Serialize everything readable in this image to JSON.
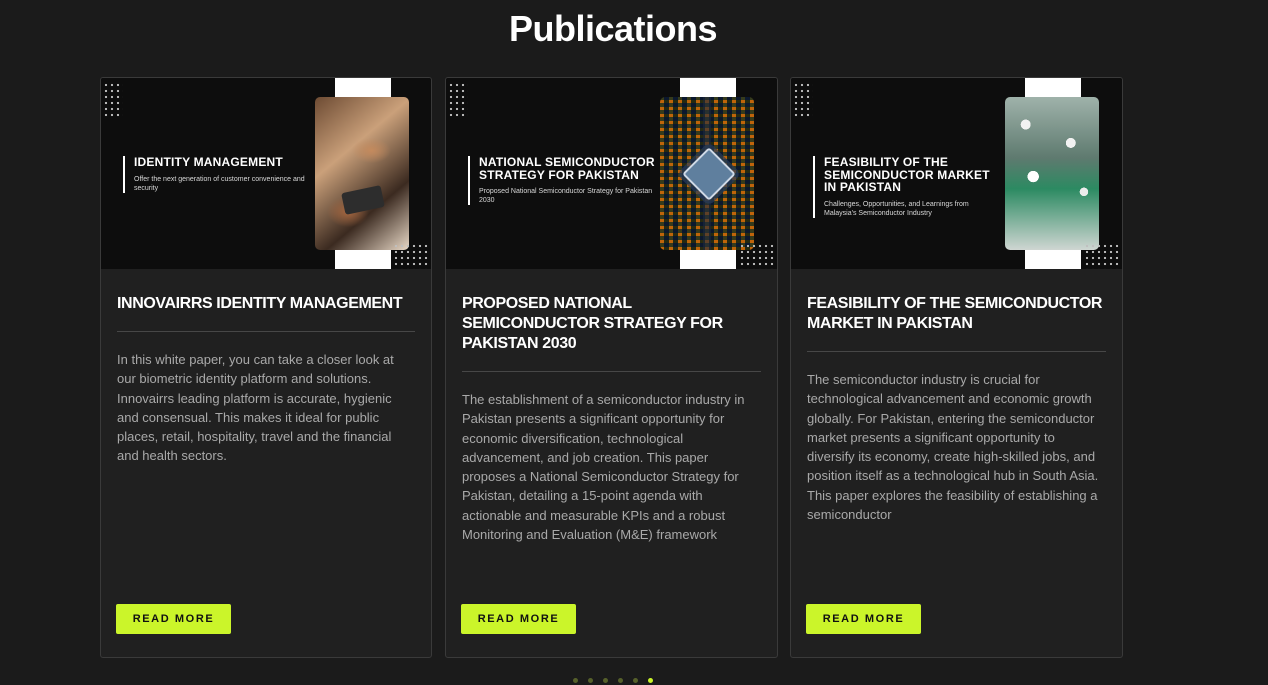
{
  "page": {
    "title": "Publications"
  },
  "cards": [
    {
      "cover_heading": "IDENTITY MANAGEMENT",
      "cover_sub": "Offer the next generation of customer convenience and security",
      "title": "INNOVAIRRS IDENTITY MANAGEMENT",
      "description": "In this white paper, you can take a closer look at our biometric identity platform and solutions. Innovairrs leading platform is accurate, hygienic and consensual. This makes it ideal for public places, retail, hospitality, travel and the financial and health sectors.",
      "button_label": "READ MORE"
    },
    {
      "cover_heading": "NATIONAL SEMICONDUCTOR STRATEGY FOR PAKISTAN",
      "cover_sub": "Proposed National Semiconductor Strategy for Pakistan 2030",
      "title": "PROPOSED NATIONAL SEMICONDUCTOR STRATEGY FOR PAKISTAN 2030",
      "description": "The establishment of a semiconductor industry in Pakistan presents a significant opportunity for economic diversification, technological advancement, and job creation. This paper proposes a National Semiconductor Strategy for Pakistan, detailing a 15-point agenda with actionable and measurable KPIs and a robust Monitoring and Evaluation (M&E) framework",
      "button_label": "READ MORE"
    },
    {
      "cover_heading": "FEASIBILITY OF THE SEMICONDUCTOR MARKET IN PAKISTAN",
      "cover_sub": "Challenges, Opportunities, and Learnings from Malaysia's Semiconductor Industry",
      "title": "FEASIBILITY OF THE SEMICONDUCTOR MARKET IN PAKISTAN",
      "description": "The semiconductor industry is crucial for technological advancement and economic growth globally. For Pakistan, entering the semiconductor market presents a significant opportunity to diversify its economy, create high-skilled jobs, and position itself as a technological hub in South Asia. This paper explores the feasibility of establishing a semiconductor",
      "button_label": "READ MORE"
    }
  ],
  "pagination": {
    "total": 6,
    "active_index": 5
  },
  "colors": {
    "background": "#1b1b1b",
    "card": "#202020",
    "accent": "#cbf52a",
    "text_muted": "#a9a9a9"
  }
}
